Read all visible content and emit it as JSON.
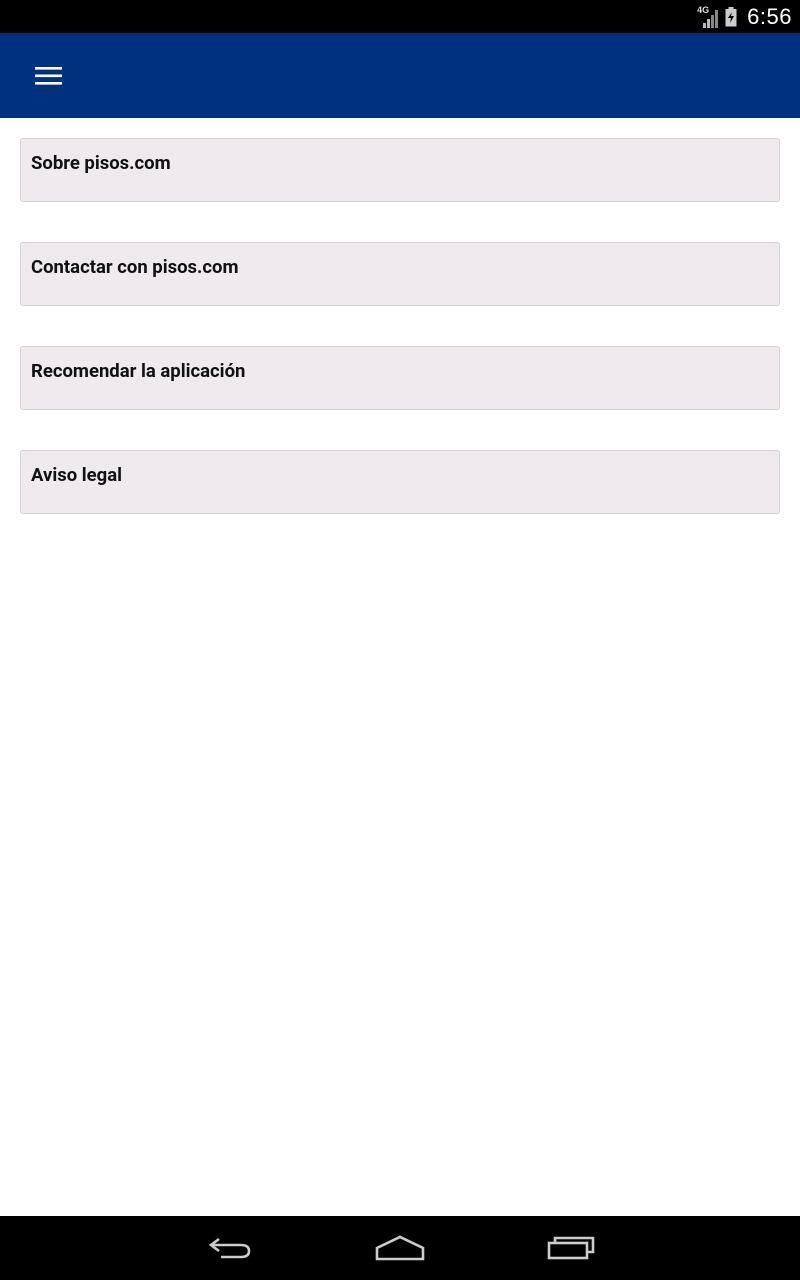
{
  "status_bar": {
    "network_type": "4G",
    "time": "6:56",
    "signal_icon": "signal-icon",
    "battery_icon": "battery-charging-icon"
  },
  "app_bar": {
    "menu_icon": "menu-icon",
    "background_color": "#00317f"
  },
  "menu_items": [
    {
      "label": "Sobre pisos.com"
    },
    {
      "label": "Contactar con pisos.com"
    },
    {
      "label": "Recomendar la aplicación"
    },
    {
      "label": "Aviso legal"
    }
  ],
  "nav_bar": {
    "back_icon": "back-icon",
    "home_icon": "home-icon",
    "recents_icon": "recents-icon"
  }
}
